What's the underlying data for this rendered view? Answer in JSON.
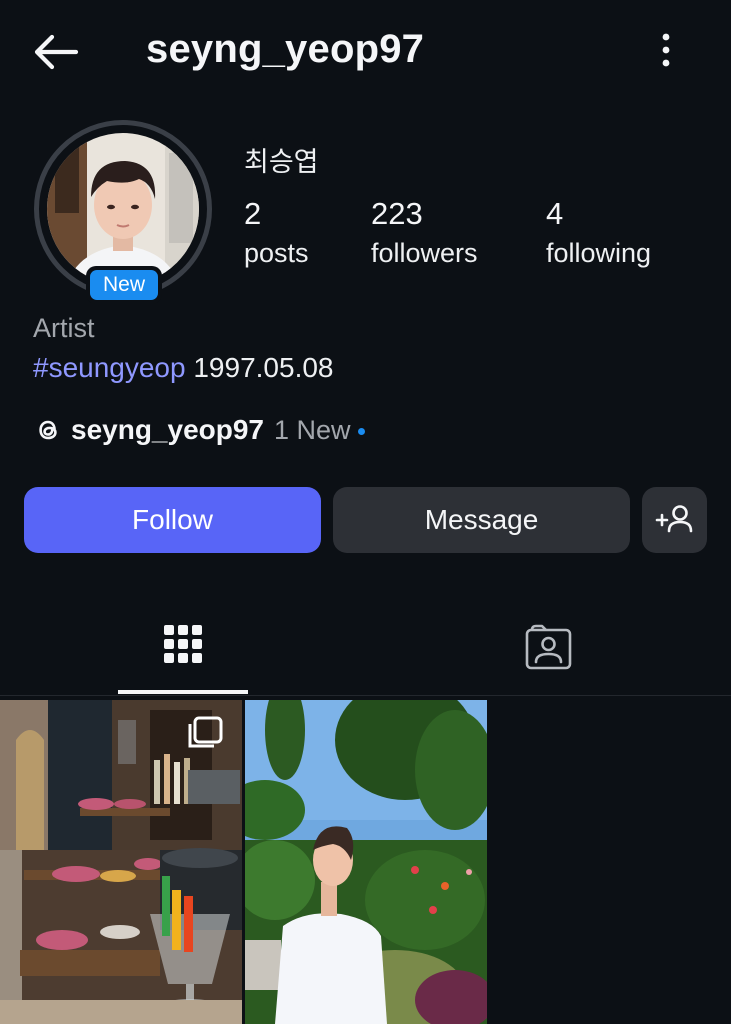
{
  "header": {
    "username": "seyng_yeop97",
    "back_icon": "arrow-left-icon",
    "more_icon": "more-vertical-icon"
  },
  "profile": {
    "full_name": "최승엽",
    "new_badge": "New",
    "stats": [
      {
        "value": "2",
        "label": "posts"
      },
      {
        "value": "223",
        "label": "followers"
      },
      {
        "value": "4",
        "label": "following"
      }
    ],
    "category": "Artist",
    "bio_hashtag": "#seungyeop",
    "bio_text": " 1997.05.08",
    "threads": {
      "handle": "seyng_yeop97",
      "new_text": "1 New",
      "icon": "threads-icon"
    }
  },
  "actions": {
    "follow_label": "Follow",
    "message_label": "Message",
    "add_user_icon": "add-person-icon"
  },
  "tabs": [
    {
      "name": "posts-grid",
      "icon": "grid-icon",
      "active": true
    },
    {
      "name": "tagged",
      "icon": "tagged-person-icon",
      "active": false
    }
  ],
  "colors": {
    "background": "#0c1015",
    "follow_button": "#5865f7",
    "secondary_button": "#2d3036",
    "hashtag": "#8f98ff",
    "badge": "#1a8cf0"
  },
  "posts": [
    {
      "icon": "carousel-icon",
      "multi_image": true
    },
    {
      "multi_image": false
    }
  ]
}
